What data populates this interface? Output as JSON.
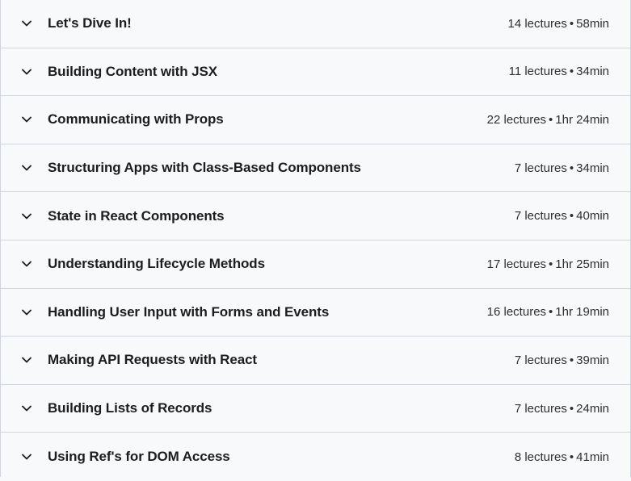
{
  "sections": [
    {
      "title": "Let's Dive In!",
      "lectures": "14 lectures",
      "duration": "58min"
    },
    {
      "title": "Building Content with JSX",
      "lectures": "11 lectures",
      "duration": "34min"
    },
    {
      "title": "Communicating with Props",
      "lectures": "22 lectures",
      "duration": "1hr 24min"
    },
    {
      "title": "Structuring Apps with Class-Based Components",
      "lectures": "7 lectures",
      "duration": "34min"
    },
    {
      "title": "State in React Components",
      "lectures": "7 lectures",
      "duration": "40min"
    },
    {
      "title": "Understanding Lifecycle Methods",
      "lectures": "17 lectures",
      "duration": "1hr 25min"
    },
    {
      "title": "Handling User Input with Forms and Events",
      "lectures": "16 lectures",
      "duration": "1hr 19min"
    },
    {
      "title": "Making API Requests with React",
      "lectures": "7 lectures",
      "duration": "39min"
    },
    {
      "title": "Building Lists of Records",
      "lectures": "7 lectures",
      "duration": "24min"
    },
    {
      "title": "Using Ref's for DOM Access",
      "lectures": "8 lectures",
      "duration": "41min"
    }
  ],
  "separator": "•",
  "icons": {
    "expand": "chevron-down-icon"
  }
}
